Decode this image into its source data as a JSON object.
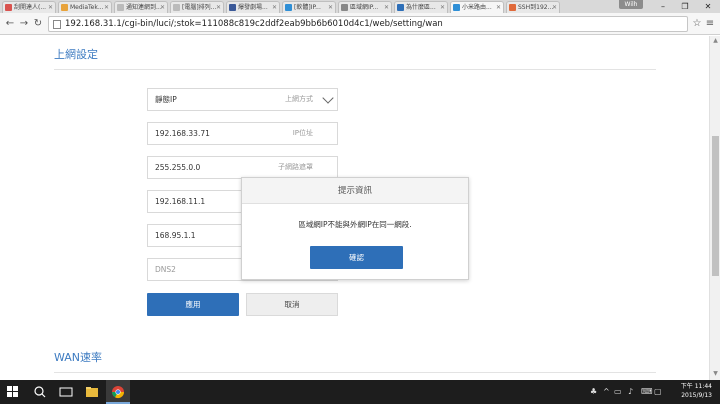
{
  "browser": {
    "tabs": [
      {
        "label": "刮開達人(...",
        "color": "#d9534f"
      },
      {
        "label": "MediaTek...",
        "color": "#e8a33b"
      },
      {
        "label": "通知連網到...",
        "color": "#bbbbbb"
      },
      {
        "label": "[電腦]排列...",
        "color": "#bbbbbb"
      },
      {
        "label": "爆發劇場...",
        "color": "#3b5998"
      },
      {
        "label": "[軟體]IP...",
        "color": "#2f8fd6"
      },
      {
        "label": "區域網IP...",
        "color": "#888888"
      },
      {
        "label": "為什麼區...",
        "color": "#2e6fb8"
      },
      {
        "label": "小米路由...",
        "color": "#2f8fd6"
      },
      {
        "label": "SSH到192...",
        "color": "#e06a3b"
      }
    ],
    "profile_label": "Wilh",
    "url": "192.168.31.1/cgi-bin/luci/;stok=111088c819c2ddf2eab9bb6b6010d4c1/web/setting/wan"
  },
  "page": {
    "section1_title": "上網設定",
    "connection_type": {
      "value": "靜態IP",
      "hint": "上網方式"
    },
    "ip": {
      "value": "192.168.33.71",
      "hint": "IP位址"
    },
    "netmask": {
      "value": "255.255.0.0",
      "hint": "子網路遮罩"
    },
    "gateway": {
      "value": "192.168.11.1"
    },
    "dns1": {
      "value": "168.95.1.1"
    },
    "dns2": {
      "placeholder": "DNS2"
    },
    "apply_label": "應用",
    "cancel_label": "取消",
    "section2_title": "WAN速率"
  },
  "dialog": {
    "title": "提示資訊",
    "message": "區域網IP不能與外網IP在同一網段.",
    "confirm_label": "確認"
  },
  "taskbar": {
    "time": "下午 11:44",
    "date": "2015/9/13"
  },
  "colors": {
    "accent": "#2e6fb8",
    "section_title": "#3d7bc1"
  }
}
